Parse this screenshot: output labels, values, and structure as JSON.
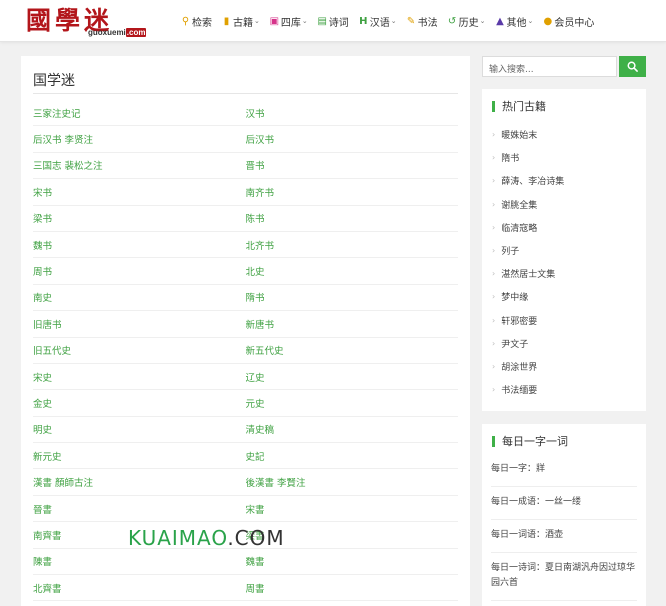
{
  "logo": {
    "chinese": "國學迷",
    "domain": "guoxuemi",
    "tld": ".com"
  },
  "nav": [
    {
      "label": "检索",
      "icon": "search-icon",
      "color": "#e0a000",
      "dropdown": false
    },
    {
      "label": "古籍",
      "icon": "book-icon",
      "color": "#e0a000",
      "dropdown": true
    },
    {
      "label": "四库",
      "icon": "camera-icon",
      "color": "#d6338a",
      "dropdown": true
    },
    {
      "label": "诗词",
      "icon": "document-icon",
      "color": "#3fa142",
      "dropdown": false
    },
    {
      "label": "汉语",
      "icon": "letter-h-icon",
      "color": "#3fa142",
      "dropdown": true
    },
    {
      "label": "书法",
      "icon": "edit-icon",
      "color": "#e0a000",
      "dropdown": false
    },
    {
      "label": "历史",
      "icon": "history-icon",
      "color": "#3fa142",
      "dropdown": true
    },
    {
      "label": "其他",
      "icon": "folder-icon",
      "color": "#5a3aa8",
      "dropdown": true
    },
    {
      "label": "会员中心",
      "icon": "user-icon",
      "color": "#e0a000",
      "dropdown": false
    }
  ],
  "main": {
    "title": "国学迷",
    "books": [
      [
        "三家注史记",
        "汉书"
      ],
      [
        "后汉书 李贤注",
        "后汉书"
      ],
      [
        "三国志 裴松之注",
        "晋书"
      ],
      [
        "宋书",
        "南齐书"
      ],
      [
        "梁书",
        "陈书"
      ],
      [
        "魏书",
        "北齐书"
      ],
      [
        "周书",
        "北史"
      ],
      [
        "南史",
        "隋书"
      ],
      [
        "旧唐书",
        "新唐书"
      ],
      [
        "旧五代史",
        "新五代史"
      ],
      [
        "宋史",
        "辽史"
      ],
      [
        "金史",
        "元史"
      ],
      [
        "明史",
        "清史稿"
      ],
      [
        "新元史",
        "史記"
      ],
      [
        "漢書 顏師古注",
        "後漢書 李賢注"
      ],
      [
        "晉書",
        "宋書"
      ],
      [
        "南齊書",
        "梁書"
      ],
      [
        "陳書",
        "魏書"
      ],
      [
        "北齊書",
        "周書"
      ]
    ]
  },
  "search": {
    "placeholder": "输入搜索..."
  },
  "sidebar": {
    "hot_title": "热门古籍",
    "hot_items": [
      "暖姝始末",
      "隋书",
      "薛涛、李冶诗集",
      "谢朓全集",
      "临清寇略",
      "列子",
      "湛然居士文集",
      "梦中缘",
      "轩邪密要",
      "尹文子",
      "胡涂世界",
      "书法缅要"
    ],
    "daily_title": "每日一字一词",
    "daily_items": [
      "每日一字：牂",
      "每日一成语：一丝一缕",
      "每日一词语：酒壶",
      "每日一诗词：夏日南湖汎舟因过琼华园六首"
    ]
  },
  "watermark": {
    "left": "KUAIMAO",
    "right": ".COM"
  },
  "colors": {
    "accent": "#3fb048",
    "link": "#3fa142",
    "logo": "#b3161b"
  }
}
